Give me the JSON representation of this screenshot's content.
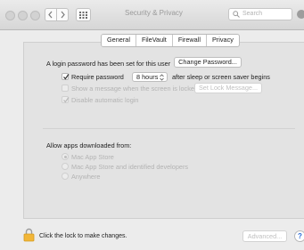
{
  "window": {
    "title": "Security & Privacy",
    "search_placeholder": "Search"
  },
  "tabs": [
    {
      "label": "General",
      "active": true
    },
    {
      "label": "FileVault",
      "active": false
    },
    {
      "label": "Firewall",
      "active": false
    },
    {
      "label": "Privacy",
      "active": false
    }
  ],
  "general": {
    "login_password_text": "A login password has been set for this user",
    "change_password_button": "Change Password...",
    "require_password": {
      "label": "Require password",
      "checked": true,
      "selected_value": "8 hours",
      "suffix": "after sleep or screen saver begins"
    },
    "show_message": {
      "label": "Show a message when the screen is locked",
      "checked": false,
      "button": "Set Lock Message..."
    },
    "disable_auto_login": {
      "label": "Disable automatic login",
      "checked": true
    }
  },
  "allow_apps": {
    "heading": "Allow apps downloaded from:",
    "options": [
      {
        "label": "Mac App Store",
        "selected": true
      },
      {
        "label": "Mac App Store and identified developers",
        "selected": false
      },
      {
        "label": "Anywhere",
        "selected": false
      }
    ]
  },
  "footer": {
    "lock_text": "Click the lock to make changes.",
    "advanced_button": "Advanced...",
    "help_label": "?"
  },
  "colors": {
    "accent_help": "#2a6bd8",
    "lock_fill": "#f2b638"
  }
}
